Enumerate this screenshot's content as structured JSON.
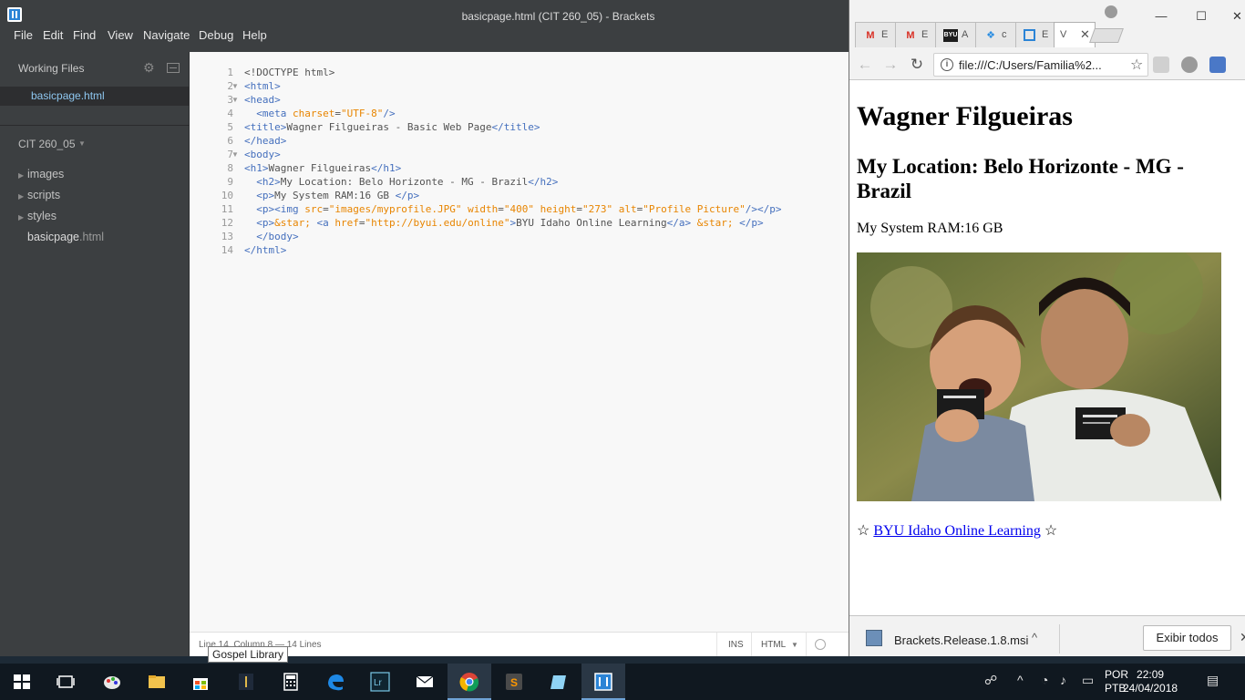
{
  "brackets": {
    "window_title": "basicpage.html (CIT 260_05) - Brackets",
    "menu": [
      "File",
      "Edit",
      "Find",
      "View",
      "Navigate",
      "Debug",
      "Help"
    ],
    "working_files_label": "Working Files",
    "working_files": [
      "basicpage.html"
    ],
    "project_name": "CIT 260_05",
    "tree": {
      "folders": [
        "images",
        "scripts",
        "styles"
      ],
      "file_base": "basicpage",
      "file_ext": ".html"
    },
    "code_lines": [
      "<!DOCTYPE html>",
      "<html>",
      "<head>",
      "  <meta charset=\"UTF-8\"/>",
      "<title>Wagner Filgueiras - Basic Web Page</title>",
      "</head>",
      "<body>",
      "<h1>Wagner Filgueiras</h1>",
      "  <h2>My Location: Belo Horizonte - MG - Brazil</h2>",
      "  <p>My System RAM:16 GB </p>",
      "  <p><img src=\"images/myprofile.JPG\" width=\"400\" height=\"273\" alt=\"Profile Picture\"/></p>",
      "  <p>&star; <a href=\"http://byui.edu/online\">BYU Idaho Online Learning</a> &star; </p>",
      "  </body>",
      "</html>"
    ],
    "status": {
      "cursor": "Line 14, Column 8 — 14 Lines",
      "mode": "INS",
      "language": "HTML"
    },
    "tooltip": "Gospel Library"
  },
  "chrome": {
    "tabs": [
      {
        "icon": "gmail-icon",
        "title": "E"
      },
      {
        "icon": "gmail-icon",
        "title": "E"
      },
      {
        "icon": "byu-icon",
        "title": "A"
      },
      {
        "icon": "dropbox-icon",
        "title": "c"
      },
      {
        "icon": "brackets-icon",
        "title": "E"
      },
      {
        "icon": "page-icon",
        "title": "V"
      }
    ],
    "url": "file:///C:/Users/Familia%2...",
    "page": {
      "h1": "Wagner Filgueiras",
      "h2": "My Location: Belo Horizonte - MG - Brazil",
      "ram": "My System RAM:16 GB",
      "star": "☆",
      "link_text": "BYU Idaho Online Learning",
      "photo_alt": "Profile Picture"
    },
    "download": {
      "filename": "Brackets.Release.1.8.msi",
      "show_all": "Exibir todos"
    }
  },
  "taskbar": {
    "lang_line1": "POR",
    "lang_line2": "PTB",
    "time": "22:09",
    "date": "24/04/2018"
  },
  "colors": {
    "brackets_bg": "#3c3f41",
    "editor_bg": "#f8f8f8",
    "tag": "#446fbd",
    "attr": "#e88501",
    "link": "#0000ee",
    "taskbar": "#101820"
  }
}
